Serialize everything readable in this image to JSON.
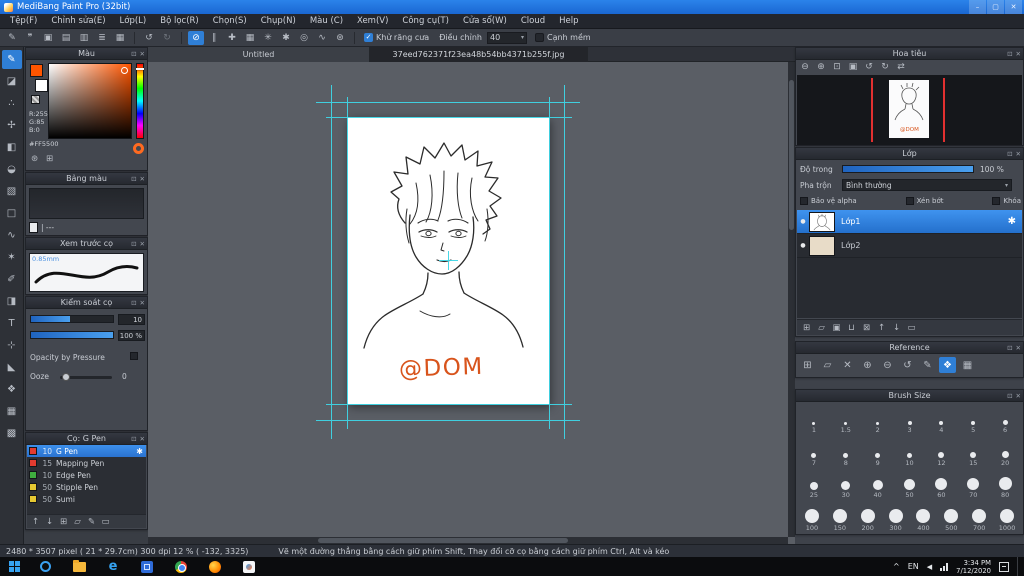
{
  "window": {
    "title": "MediBang Paint Pro (32bit)",
    "controls": {
      "min": "–",
      "max": "▢",
      "close": "✕"
    }
  },
  "menu": [
    "Tệp(F)",
    "Chỉnh sửa(E)",
    "Lớp(L)",
    "Bộ lọc(R)",
    "Chọn(S)",
    "Chụp(N)",
    "Màu (C)",
    "Xem(V)",
    "Công cụ(T)",
    "Cửa sổ(W)",
    "Cloud",
    "Help"
  ],
  "ui": {
    "popout_icon": "⊡",
    "close_icon": "✕",
    "caret_icon": "▾",
    "check_icon": "✓",
    "eye_icon": "●",
    "gear_icon": "✱",
    "undo_icon": "↺",
    "redo_icon": "↻",
    "tray_expand": "^",
    "speaker_icon": "◀"
  },
  "toolbar": {
    "left_icons": [
      {
        "name": "pen-icon",
        "glyph": "✎"
      },
      {
        "name": "comment-icon",
        "glyph": "❞"
      },
      {
        "name": "pages-icon",
        "glyph": "▣"
      },
      {
        "name": "book-icon",
        "glyph": "▤"
      },
      {
        "name": "columns-icon",
        "glyph": "▥"
      },
      {
        "name": "list-icon",
        "glyph": "≣"
      },
      {
        "name": "grid-icon",
        "glyph": "▦"
      }
    ],
    "snap_icons": [
      {
        "name": "snap-off-icon",
        "glyph": "⊘",
        "active": true
      },
      {
        "name": "snap-parallel-icon",
        "glyph": "∥"
      },
      {
        "name": "snap-cross-icon",
        "glyph": "✚"
      },
      {
        "name": "snap-grid-icon",
        "glyph": "▦"
      },
      {
        "name": "snap-vanishing-icon",
        "glyph": "✳"
      },
      {
        "name": "snap-radial-icon",
        "glyph": "✱"
      },
      {
        "name": "snap-circle-icon",
        "glyph": "◎"
      },
      {
        "name": "snap-curve-icon",
        "glyph": "∿"
      },
      {
        "name": "snap-settings-icon",
        "glyph": "⊛"
      }
    ],
    "antialias_label": "Khử răng cưa",
    "correction_label": "Điều chỉnh",
    "correction_value": "40",
    "softedge_label": "Cạnh mềm"
  },
  "tabs": [
    {
      "label": "Untitled",
      "active": false
    },
    {
      "label": "37eed762371f23ea48b54bb4371b255f.jpg",
      "active": true
    }
  ],
  "tools": [
    {
      "name": "brush-tool",
      "glyph": "✎",
      "active": true
    },
    {
      "name": "eraser-tool",
      "glyph": "◪"
    },
    {
      "name": "dot-tool",
      "glyph": "∴"
    },
    {
      "name": "move-tool",
      "glyph": "✢"
    },
    {
      "name": "fill-tool",
      "glyph": "◧"
    },
    {
      "name": "bucket-tool",
      "glyph": "◒"
    },
    {
      "name": "gradient-tool",
      "glyph": "▧"
    },
    {
      "name": "select-tool",
      "glyph": "□"
    },
    {
      "name": "lasso-tool",
      "glyph": "∿"
    },
    {
      "name": "magic-wand-tool",
      "glyph": "✶"
    },
    {
      "name": "select-pen-tool",
      "glyph": "✐"
    },
    {
      "name": "select-eraser-tool",
      "glyph": "◨"
    },
    {
      "name": "text-tool",
      "glyph": "T"
    },
    {
      "name": "operation-tool",
      "glyph": "⊹"
    },
    {
      "name": "eyedropper-tool",
      "glyph": "◣"
    },
    {
      "name": "hand-tool",
      "glyph": "❖"
    },
    {
      "name": "divide-tool",
      "glyph": "▦"
    },
    {
      "name": "material-tool",
      "glyph": "▩"
    }
  ],
  "color_panel": {
    "title": "Màu",
    "r": "R:255",
    "g": "G:85",
    "b": "B:0",
    "hex": "#FF5500",
    "foreground": "#ff5500",
    "bottom_icons": [
      {
        "name": "web-color-icon",
        "glyph": "⊛"
      },
      {
        "name": "add-palette-icon",
        "glyph": "⊞"
      }
    ]
  },
  "palette_panel": {
    "title": "Bảng màu",
    "entry": "| ---"
  },
  "preview_panel": {
    "title": "Xem trước cọ",
    "size_label": "0.85mm"
  },
  "control_panel": {
    "title": "Kiểm soát cọ",
    "size_value": "10",
    "opacity_value": "100 %",
    "pressure_label": "Opacity by Pressure",
    "ooze_label": "Ooze",
    "ooze_value": "0"
  },
  "brush_panel": {
    "title": "Cọ: G Pen",
    "brushes": [
      {
        "size": "10",
        "name": "G Pen",
        "color": "#e23b30",
        "selected": true
      },
      {
        "size": "15",
        "name": "Mapping Pen",
        "color": "#e23b30"
      },
      {
        "size": "10",
        "name": "Edge Pen",
        "color": "#3fae3f"
      },
      {
        "size": "50",
        "name": "Stipple Pen",
        "color": "#e6c932"
      },
      {
        "size": "50",
        "name": "Sumi",
        "color": "#e6c932"
      }
    ],
    "bottom_icons": [
      {
        "name": "move-up-icon",
        "glyph": "↑"
      },
      {
        "name": "move-down-icon",
        "glyph": "↓"
      },
      {
        "name": "add-brush-icon",
        "glyph": "⊞"
      },
      {
        "name": "brush-folder-icon",
        "glyph": "▱"
      },
      {
        "name": "edit-brush-icon",
        "glyph": "✎"
      },
      {
        "name": "delete-brush-icon",
        "glyph": "▭"
      }
    ]
  },
  "navigator": {
    "title": "Hoa tiêu",
    "zoom_icons": [
      {
        "name": "zoom-out-icon",
        "glyph": "⊖"
      },
      {
        "name": "zoom-in-icon",
        "glyph": "⊕"
      },
      {
        "name": "fit-window-icon",
        "glyph": "⊡"
      },
      {
        "name": "actual-size-icon",
        "glyph": "▣"
      },
      {
        "name": "rotate-left-icon",
        "glyph": "↺"
      },
      {
        "name": "rotate-right-icon",
        "glyph": "↻"
      },
      {
        "name": "flip-view-icon",
        "glyph": "⇄"
      }
    ]
  },
  "layers_panel": {
    "title": "Lớp",
    "opacity_label": "Độ trong",
    "opacity_value": "100 %",
    "blend_label": "Pha trộn",
    "blend_value": "Bình thường",
    "options": [
      "Bảo vệ alpha",
      "Xén bớt",
      "Khóa"
    ],
    "layers": [
      {
        "name": "Lớp1",
        "selected": true
      },
      {
        "name": "Lớp2",
        "selected": false
      }
    ],
    "bottom_icons": [
      {
        "name": "new-layer-icon",
        "glyph": "⊞"
      },
      {
        "name": "new-folder-icon",
        "glyph": "▱"
      },
      {
        "name": "duplicate-layer-icon",
        "glyph": "▣"
      },
      {
        "name": "merge-layer-icon",
        "glyph": "⊔"
      },
      {
        "name": "clear-layer-icon",
        "glyph": "⊠"
      },
      {
        "name": "move-up-icon",
        "glyph": "↑"
      },
      {
        "name": "move-down-icon",
        "glyph": "↓"
      },
      {
        "name": "delete-layer-icon",
        "glyph": "▭"
      }
    ]
  },
  "reference_panel": {
    "title": "Reference",
    "icons": [
      {
        "name": "open-image-icon",
        "glyph": "⊞"
      },
      {
        "name": "folder-icon",
        "glyph": "▱"
      },
      {
        "name": "close-image-icon",
        "glyph": "✕"
      },
      {
        "name": "zoom-in-icon",
        "glyph": "⊕"
      },
      {
        "name": "zoom-out-icon",
        "glyph": "⊖"
      },
      {
        "name": "reset-view-icon",
        "glyph": "↺"
      },
      {
        "name": "eyedropper-icon",
        "glyph": "✎"
      },
      {
        "name": "hand-icon",
        "glyph": "❖",
        "active": true
      },
      {
        "name": "grid-icon",
        "glyph": "▦"
      }
    ]
  },
  "brush_size_panel": {
    "title": "Brush Size",
    "rows": [
      [
        "1",
        "1.5",
        "2",
        "3",
        "4",
        "5",
        "6"
      ],
      [
        "7",
        "8",
        "9",
        "10",
        "12",
        "15",
        "20"
      ],
      [
        "25",
        "30",
        "40",
        "50",
        "60",
        "70",
        "80"
      ],
      [
        "100",
        "150",
        "200",
        "300",
        "400",
        "500",
        "700",
        "1000"
      ]
    ]
  },
  "canvas": {
    "signature": "@DOM",
    "guide_color": "#3fd6e6",
    "accent": "#d8541c"
  },
  "statusbar": {
    "info": "2480 * 3507 pixel   ( 21 * 29.7cm)   300 dpi   12 %   ( -132, 3325)",
    "hint": "Vẽ một đường thẳng bằng cách giữ phím Shift, Thay đổi cỡ cọ bằng cách giữ phím Ctrl, Alt và kéo"
  },
  "taskbar": {
    "apps": [
      {
        "name": "cortana-icon"
      },
      {
        "name": "file-explorer-icon"
      },
      {
        "name": "edge-icon",
        "glyph": "e"
      },
      {
        "name": "blue-app-icon"
      },
      {
        "name": "chrome-icon"
      },
      {
        "name": "firefox-icon"
      },
      {
        "name": "medibang-icon"
      }
    ],
    "lang": "EN",
    "time": "3:34 PM",
    "date": "7/12/2020"
  }
}
